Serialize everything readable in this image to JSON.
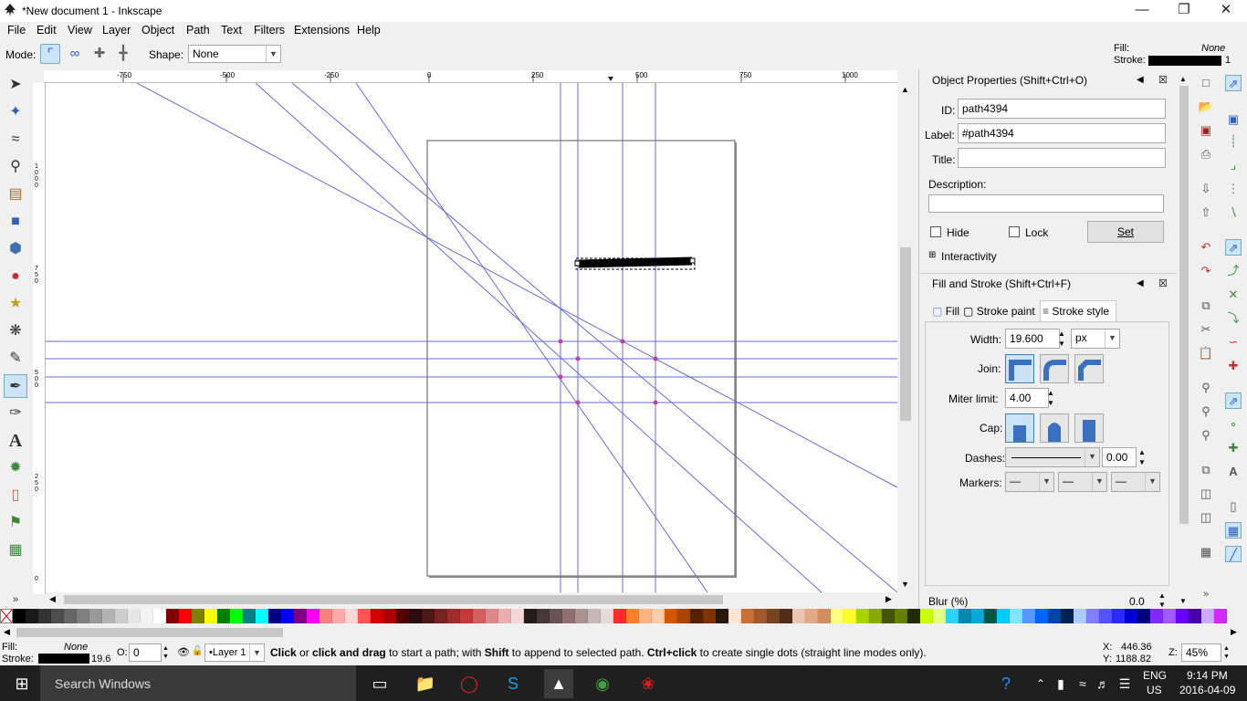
{
  "window": {
    "title": "*New document 1 - Inkscape"
  },
  "menu": [
    "File",
    "Edit",
    "View",
    "Layer",
    "Object",
    "Path",
    "Text",
    "Filters",
    "Extensions",
    "Help"
  ],
  "fill_stroke_indicator": {
    "fill_label": "Fill:",
    "fill_value": "None",
    "stroke_label": "Stroke:",
    "stroke_width": "1"
  },
  "tool_controls": {
    "mode_label": "Mode:",
    "shape_label": "Shape:",
    "shape_value": "None"
  },
  "rulers": {
    "h_ticks": [
      "-750",
      "-500",
      "-250",
      "0",
      "250",
      "500",
      "750",
      "1000"
    ],
    "v_ticks": [
      "1000",
      "750",
      "500",
      "250",
      "0"
    ]
  },
  "object_properties": {
    "title": "Object Properties (Shift+Ctrl+O)",
    "id_label": "ID:",
    "id_value": "path4394",
    "label_label": "Label:",
    "label_value": "#path4394",
    "title_label": "Title:",
    "title_value": "",
    "description_label": "Description:",
    "hide_label": "Hide",
    "lock_label": "Lock",
    "set_label": "Set",
    "interactivity_label": "Interactivity"
  },
  "fill_and_stroke": {
    "title": "Fill and Stroke (Shift+Ctrl+F)",
    "tabs": [
      "Fill",
      "Stroke paint",
      "Stroke style"
    ],
    "width_label": "Width:",
    "width_value": "19.600",
    "width_unit": "px",
    "join_label": "Join:",
    "miter_label": "Miter limit:",
    "miter_value": "4.00",
    "cap_label": "Cap:",
    "dashes_label": "Dashes:",
    "dashes_value": "0.00",
    "markers_label": "Markers:",
    "blur_label": "Blur (%)",
    "blur_value": "0.0"
  },
  "palette": [
    "#000000",
    "#1a1a1a",
    "#333333",
    "#4d4d4d",
    "#666666",
    "#808080",
    "#999999",
    "#b3b3b3",
    "#cccccc",
    "#e6e6e6",
    "#f2f2f2",
    "#ffffff",
    "#800000",
    "#ff0000",
    "#808000",
    "#ffff00",
    "#008000",
    "#00ff00",
    "#008080",
    "#00ffff",
    "#000080",
    "#0000ff",
    "#800080",
    "#ff00ff",
    "#ff8080",
    "#ffaaaa",
    "#ffd5d5",
    "#ff5555",
    "#d40000",
    "#aa0000",
    "#550000",
    "#280b0b",
    "#501616",
    "#782121",
    "#a02c2c",
    "#c83737",
    "#d35f5f",
    "#de8787",
    "#e9afaf",
    "#f4d7d7",
    "#241c1c",
    "#483737",
    "#6c5353",
    "#916f6f",
    "#ac9393",
    "#c8b7b7",
    "#e3dbdb",
    "#ff2a2a",
    "#ff7f2a",
    "#ffb380",
    "#ffccaa",
    "#d45500",
    "#aa4400",
    "#552200",
    "#803300",
    "#28170b",
    "#ffe6d5",
    "#c87137",
    "#a05a2c",
    "#784421",
    "#502d16",
    "#e9c6af",
    "#deaa87",
    "#d38d5f",
    "#ffff80",
    "#ffff2a",
    "#aad400",
    "#88aa00",
    "#445500",
    "#668000",
    "#222b00",
    "#ccff00",
    "#e5ff80",
    "#2ad4ff",
    "#0088aa",
    "#00aad4",
    "#005544",
    "#00ccff",
    "#80e5ff",
    "#5599ff",
    "#0066ff",
    "#0044aa",
    "#002255",
    "#aaccff",
    "#8080ff",
    "#5555ff",
    "#2a2aff",
    "#0000d4",
    "#000080",
    "#7f2aff",
    "#a05aff",
    "#6600ff",
    "#4400aa",
    "#ccaaff",
    "#d42aff"
  ],
  "status": {
    "fill_label": "Fill:",
    "fill_value": "None",
    "stroke_label": "Stroke:",
    "stroke_width": "19.6",
    "opacity_label": "O:",
    "opacity_value": "0",
    "layer": "•Layer 1",
    "message_b1": "Click",
    "message_t1": " or ",
    "message_b2": "click and drag",
    "message_t2": " to start a path; with ",
    "message_b3": "Shift",
    "message_t3": " to append to selected path. ",
    "message_b4": "Ctrl+click",
    "message_t4": " to create single dots (straight line modes only).",
    "x_label": "X:",
    "x_value": "446.36",
    "y_label": "Y:",
    "y_value": "1188.82",
    "zoom_label": "Z:",
    "zoom_value": "45%"
  },
  "taskbar": {
    "search_placeholder": "Search Windows",
    "lang1": "ENG",
    "lang2": "US",
    "time": "9:14 PM",
    "date": "2016-04-09"
  }
}
